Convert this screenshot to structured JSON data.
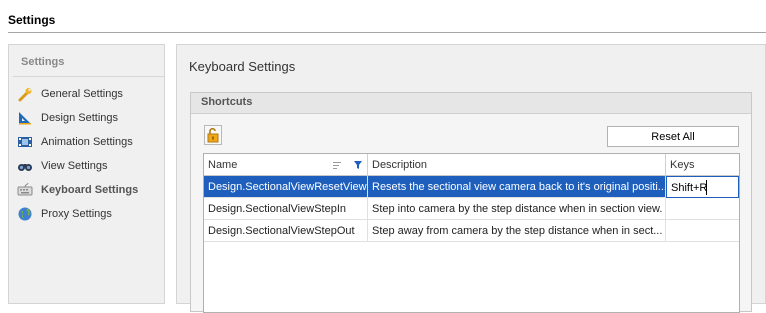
{
  "page": {
    "title": "Settings"
  },
  "sidebar": {
    "heading": "Settings",
    "items": [
      {
        "label": "General Settings",
        "icon": "wrench-icon"
      },
      {
        "label": "Design Settings",
        "icon": "ruler-icon"
      },
      {
        "label": "Animation Settings",
        "icon": "film-icon"
      },
      {
        "label": "View Settings",
        "icon": "binoculars-icon"
      },
      {
        "label": "Keyboard Settings",
        "icon": "keyboard-icon",
        "active": true
      },
      {
        "label": "Proxy Settings",
        "icon": "globe-icon"
      }
    ]
  },
  "main": {
    "heading": "Keyboard Settings",
    "group": {
      "title": "Shortcuts",
      "reset_label": "Reset All",
      "columns": [
        "Name",
        "Description",
        "Keys"
      ],
      "rows": [
        {
          "name": "Design.SectionalViewResetView",
          "description": "Resets the sectional view camera back to it's original positi...",
          "keys": "Shift+R"
        },
        {
          "name": "Design.SectionalViewStepIn",
          "description": "Step into camera by the step distance when in section view.",
          "keys": ""
        },
        {
          "name": "Design.SectionalViewStepOut",
          "description": "Step away from camera by the step distance when in sect...",
          "keys": ""
        }
      ]
    }
  },
  "colors": {
    "selection": "#1e5fbd",
    "accent": "#e8a317"
  }
}
